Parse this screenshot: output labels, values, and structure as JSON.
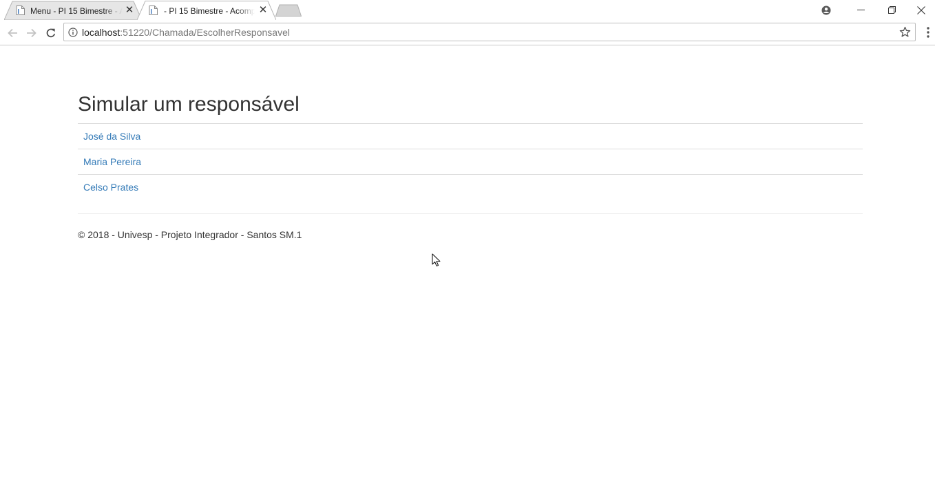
{
  "browser": {
    "tabs": [
      {
        "title": "Menu - PI 15 Bimestre - A",
        "active": false
      },
      {
        "title": "- PI 15 Bimestre - Acomp",
        "active": true
      }
    ],
    "url": {
      "host": "localhost",
      "path": ":51220/Chamada/EscolherResponsavel"
    }
  },
  "page": {
    "title": "Simular um responsável",
    "responsaveis": [
      {
        "name": "José da Silva"
      },
      {
        "name": "Maria Pereira"
      },
      {
        "name": "Celso Prates"
      }
    ],
    "footer": "© 2018 - Univesp - Projeto Integrador - Santos SM.1"
  },
  "colors": {
    "link": "#337ab7",
    "text": "#333333",
    "divider": "#dddddd"
  }
}
